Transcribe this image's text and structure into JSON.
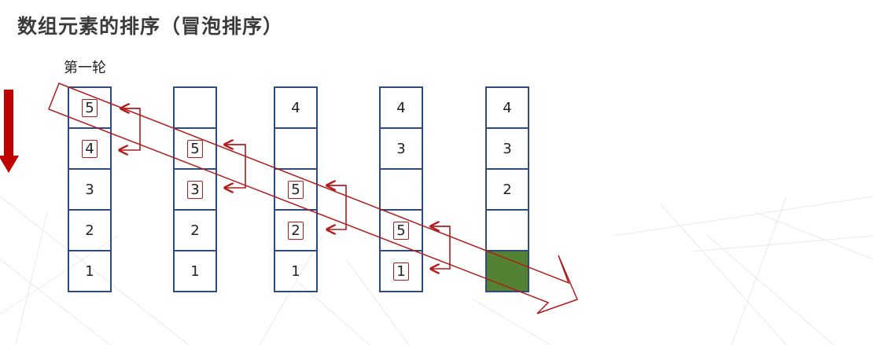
{
  "title": "数组元素的排序（冒泡排序）",
  "round_label": "第一轮",
  "columns": [
    {
      "cells": [
        {
          "value": "5",
          "highlight": true
        },
        {
          "value": "4",
          "highlight": true
        },
        {
          "value": "3",
          "highlight": false
        },
        {
          "value": "2",
          "highlight": false
        },
        {
          "value": "1",
          "highlight": false
        }
      ]
    },
    {
      "cells": [
        {
          "value": "",
          "highlight": false
        },
        {
          "value": "5",
          "highlight": true
        },
        {
          "value": "3",
          "highlight": true
        },
        {
          "value": "2",
          "highlight": false
        },
        {
          "value": "1",
          "highlight": false
        }
      ]
    },
    {
      "cells": [
        {
          "value": "4",
          "highlight": false
        },
        {
          "value": "",
          "highlight": false
        },
        {
          "value": "5",
          "highlight": true
        },
        {
          "value": "2",
          "highlight": true
        },
        {
          "value": "1",
          "highlight": false
        }
      ]
    },
    {
      "cells": [
        {
          "value": "4",
          "highlight": false
        },
        {
          "value": "3",
          "highlight": false
        },
        {
          "value": "",
          "highlight": false
        },
        {
          "value": "5",
          "highlight": true
        },
        {
          "value": "1",
          "highlight": true
        }
      ]
    },
    {
      "cells": [
        {
          "value": "4",
          "highlight": false
        },
        {
          "value": "3",
          "highlight": false
        },
        {
          "value": "2",
          "highlight": false
        },
        {
          "value": "",
          "highlight": false
        },
        {
          "value": "",
          "highlight": false,
          "filled": true
        }
      ]
    }
  ],
  "colors": {
    "cell_border": "#2f4b7c",
    "highlight": "#b11b1b",
    "arrow": "#b11b1b",
    "down_arrow": "#c00000",
    "filled_cell": "#548235"
  }
}
